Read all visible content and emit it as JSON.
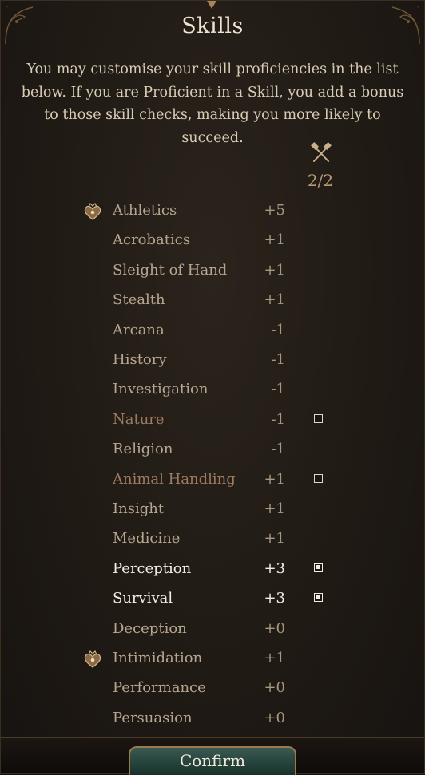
{
  "title": "Skills",
  "description": "You may customise your skill proficiencies in the list below. If you are Proficient in a Skill, you add a bonus to those skill checks, making you more likely to succeed.",
  "proficiency_column": {
    "icon": "crossed-hammers-icon",
    "counter": "2/2"
  },
  "skills": [
    {
      "name": "Athletics",
      "bonus": "+5",
      "class_proficient": true,
      "choosable": false,
      "selected": false,
      "style": "normal"
    },
    {
      "name": "Acrobatics",
      "bonus": "+1",
      "class_proficient": false,
      "choosable": false,
      "selected": false,
      "style": "normal"
    },
    {
      "name": "Sleight of Hand",
      "bonus": "+1",
      "class_proficient": false,
      "choosable": false,
      "selected": false,
      "style": "normal"
    },
    {
      "name": "Stealth",
      "bonus": "+1",
      "class_proficient": false,
      "choosable": false,
      "selected": false,
      "style": "normal"
    },
    {
      "name": "Arcana",
      "bonus": "-1",
      "class_proficient": false,
      "choosable": false,
      "selected": false,
      "style": "normal"
    },
    {
      "name": "History",
      "bonus": "-1",
      "class_proficient": false,
      "choosable": false,
      "selected": false,
      "style": "normal"
    },
    {
      "name": "Investigation",
      "bonus": "-1",
      "class_proficient": false,
      "choosable": false,
      "selected": false,
      "style": "normal"
    },
    {
      "name": "Nature",
      "bonus": "-1",
      "class_proficient": false,
      "choosable": true,
      "selected": false,
      "style": "dim"
    },
    {
      "name": "Religion",
      "bonus": "-1",
      "class_proficient": false,
      "choosable": false,
      "selected": false,
      "style": "normal"
    },
    {
      "name": "Animal Handling",
      "bonus": "+1",
      "class_proficient": false,
      "choosable": true,
      "selected": false,
      "style": "dim"
    },
    {
      "name": "Insight",
      "bonus": "+1",
      "class_proficient": false,
      "choosable": false,
      "selected": false,
      "style": "normal"
    },
    {
      "name": "Medicine",
      "bonus": "+1",
      "class_proficient": false,
      "choosable": false,
      "selected": false,
      "style": "normal"
    },
    {
      "name": "Perception",
      "bonus": "+3",
      "class_proficient": false,
      "choosable": true,
      "selected": true,
      "style": "bright"
    },
    {
      "name": "Survival",
      "bonus": "+3",
      "class_proficient": false,
      "choosable": true,
      "selected": true,
      "style": "bright"
    },
    {
      "name": "Deception",
      "bonus": "+0",
      "class_proficient": false,
      "choosable": false,
      "selected": false,
      "style": "normal"
    },
    {
      "name": "Intimidation",
      "bonus": "+1",
      "class_proficient": true,
      "choosable": false,
      "selected": false,
      "style": "normal"
    },
    {
      "name": "Performance",
      "bonus": "+0",
      "class_proficient": false,
      "choosable": false,
      "selected": false,
      "style": "normal"
    },
    {
      "name": "Persuasion",
      "bonus": "+0",
      "class_proficient": false,
      "choosable": false,
      "selected": false,
      "style": "normal"
    }
  ],
  "confirm_label": "Confirm",
  "colors": {
    "panel_bg": "#221c16",
    "text_light": "#efe4d0",
    "text_normal": "#b7a68f",
    "text_dim": "#9c7b60",
    "accent_gold": "#a58456",
    "confirm_bg": "#24413a"
  }
}
